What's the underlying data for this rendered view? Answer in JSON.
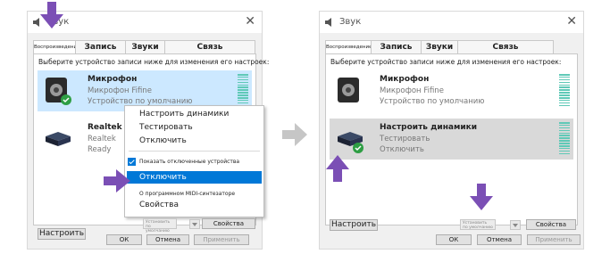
{
  "left_window": {
    "title": "Звук",
    "tabs": [
      "Воспроизведение",
      "Запись",
      "Звуки",
      "Связь"
    ],
    "instruction": "Выберите устройство записи ниже для изменения его настроек:",
    "device1": {
      "name": "Микрофон",
      "line1": "Микрофон Fifine",
      "line2": "Устройство по умолчанию"
    },
    "device2": {
      "name": "Realtek",
      "line1": "Realtek",
      "line2": "Ready"
    },
    "configure": "Настроить",
    "set_default": "Установить по умолчанию",
    "properties": "Свойства",
    "ok": "ОК",
    "cancel": "Отмена",
    "apply": "Применить"
  },
  "context_menu": {
    "configure_speakers": "Настроить динамики",
    "test": "Тестировать",
    "disable": "Отключить",
    "show_disabled": "Показать отключенные устройства",
    "disable2": "Отключить",
    "about_midi": "О программном MIDI-синтезаторе",
    "properties": "Свойства"
  },
  "right_window": {
    "title": "Звук",
    "tabs": [
      "Воспроизведение",
      "Запись",
      "Звуки",
      "Связь"
    ],
    "instruction": "Выберите устройство записи ниже для изменения его настроек:",
    "device1": {
      "name": "Микрофон",
      "line1": "Микрофон Fifine",
      "line2": "Устройство по умолчанию"
    },
    "device2": {
      "name": "Настроить динамики",
      "line1": "Тестировать",
      "line2": "Отключить"
    },
    "configure": "Настроить",
    "set_default": "Установить по умолчанию",
    "properties": "Свойства",
    "ok": "ОК",
    "cancel": "Отмена",
    "apply": "Применить"
  },
  "colors": {
    "accent": "#0078d7",
    "selection": "#cce8ff",
    "arrow": "#7b4fb5",
    "meter": "#5fc9b7"
  }
}
